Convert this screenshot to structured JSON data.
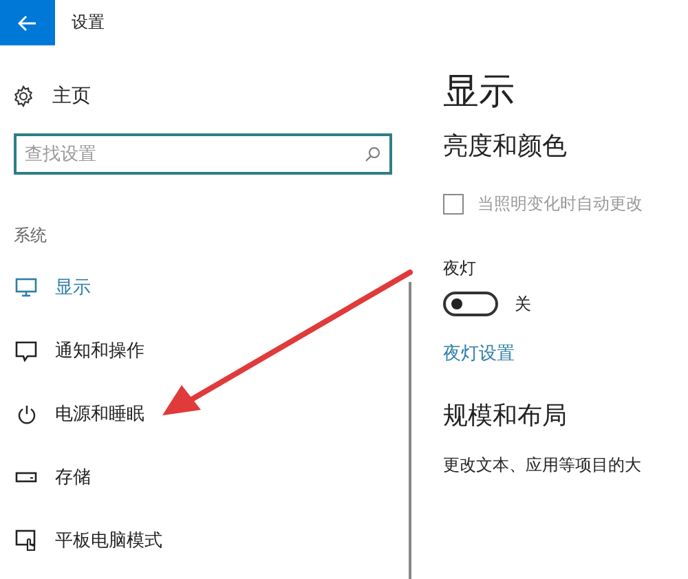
{
  "window": {
    "title": "设置"
  },
  "sidebar": {
    "home": "主页",
    "search": {
      "placeholder": "查找设置"
    },
    "section": "系统",
    "items": [
      {
        "label": "显示",
        "selected": true
      },
      {
        "label": "通知和操作",
        "selected": false
      },
      {
        "label": "电源和睡眠",
        "selected": false
      },
      {
        "label": "存储",
        "selected": false
      },
      {
        "label": "平板电脑模式",
        "selected": false
      }
    ]
  },
  "content": {
    "title": "显示",
    "brightness_heading": "亮度和颜色",
    "auto_brightness": {
      "label": "当照明变化时自动更改",
      "checked": false
    },
    "night_light": {
      "label": "夜灯",
      "on": false,
      "state_text": "关"
    },
    "night_light_link": "夜灯设置",
    "scale_heading": "规模和布局",
    "scale_text": "更改文本、应用等项目的大"
  },
  "annotations": [
    {
      "kind": "arrow"
    }
  ]
}
